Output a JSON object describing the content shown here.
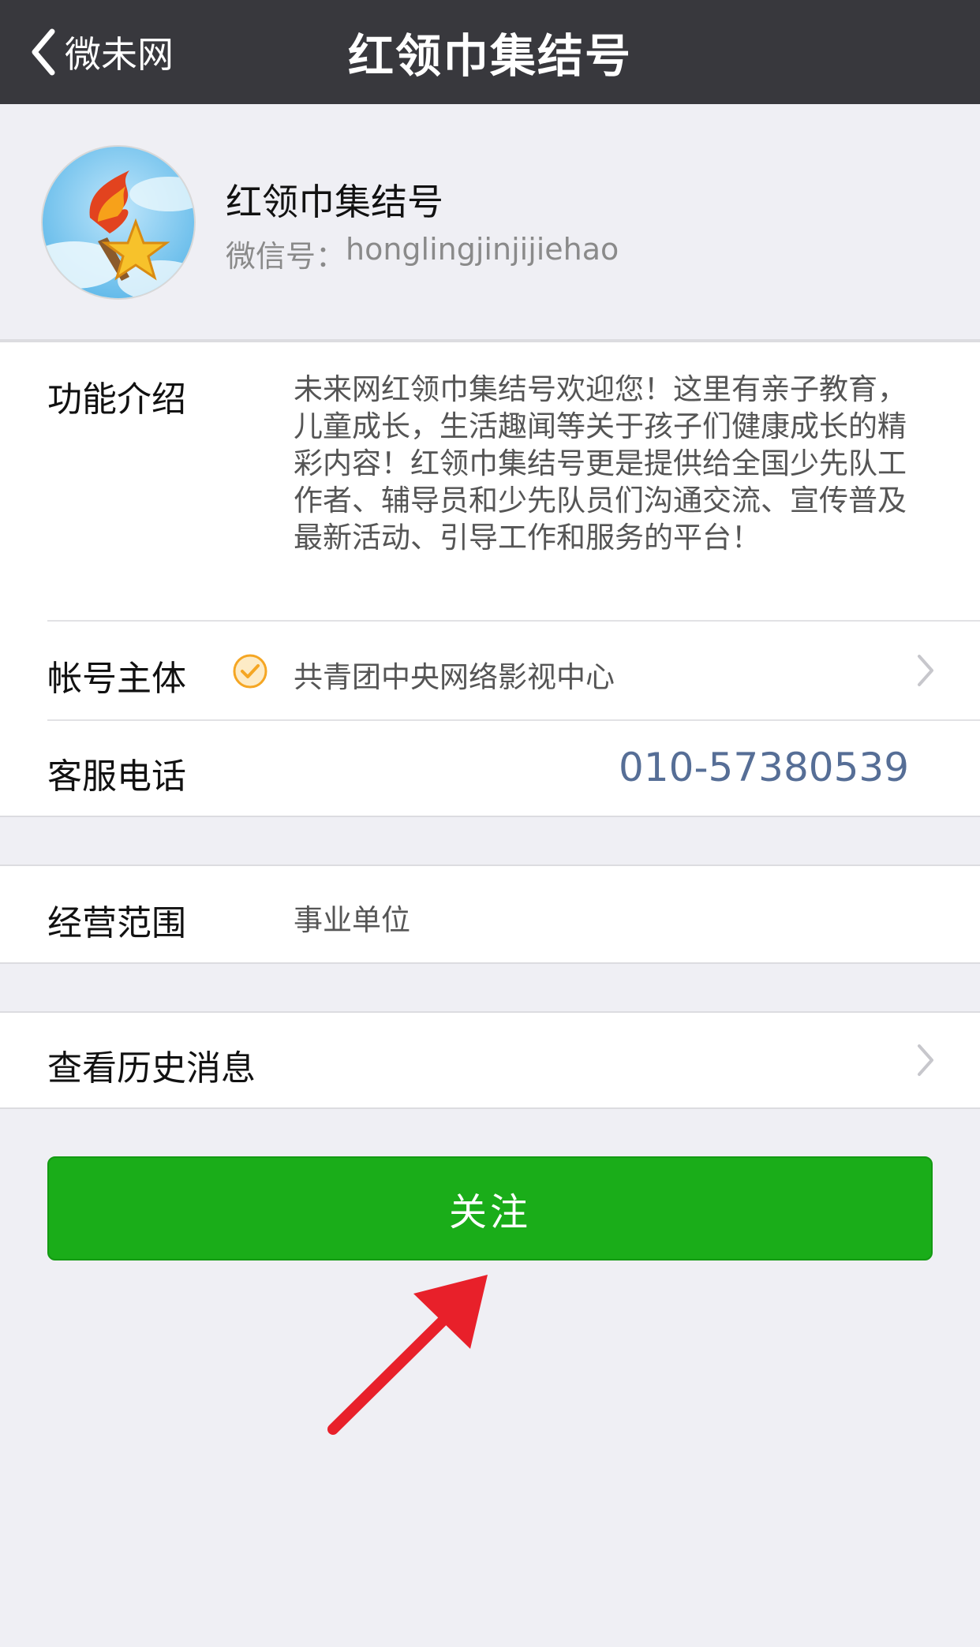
{
  "navbar": {
    "back_label": "微未网",
    "title": "红领巾集结号"
  },
  "profile": {
    "name": "红领巾集结号",
    "wechat_id_label": "微信号：",
    "wechat_id": "honglingjinjijiehao"
  },
  "info": {
    "intro_label": "功能介绍",
    "intro_text": "未来网红领巾集结号欢迎您！这里有亲子教育，儿童成长，生活趣闻等关于孩子们健康成长的精彩内容！红领巾集结号更是提供给全国少先队工作者、辅导员和少先队员们沟通交流、宣传普及最新活动、引导工作和服务的平台！",
    "owner_label": "帐号主体",
    "owner_value": "共青团中央网络影视中心",
    "phone_label": "客服电话",
    "phone_value": "010-57380539"
  },
  "business": {
    "label": "经营范围",
    "value": "事业单位"
  },
  "history": {
    "label": "查看历史消息"
  },
  "follow_button": {
    "label": "关注"
  },
  "colors": {
    "navbar": "#38383d",
    "follow": "#1aad19",
    "phone": "#566e96",
    "annotation_arrow": "#e8202a",
    "verified": "#f5a623"
  }
}
